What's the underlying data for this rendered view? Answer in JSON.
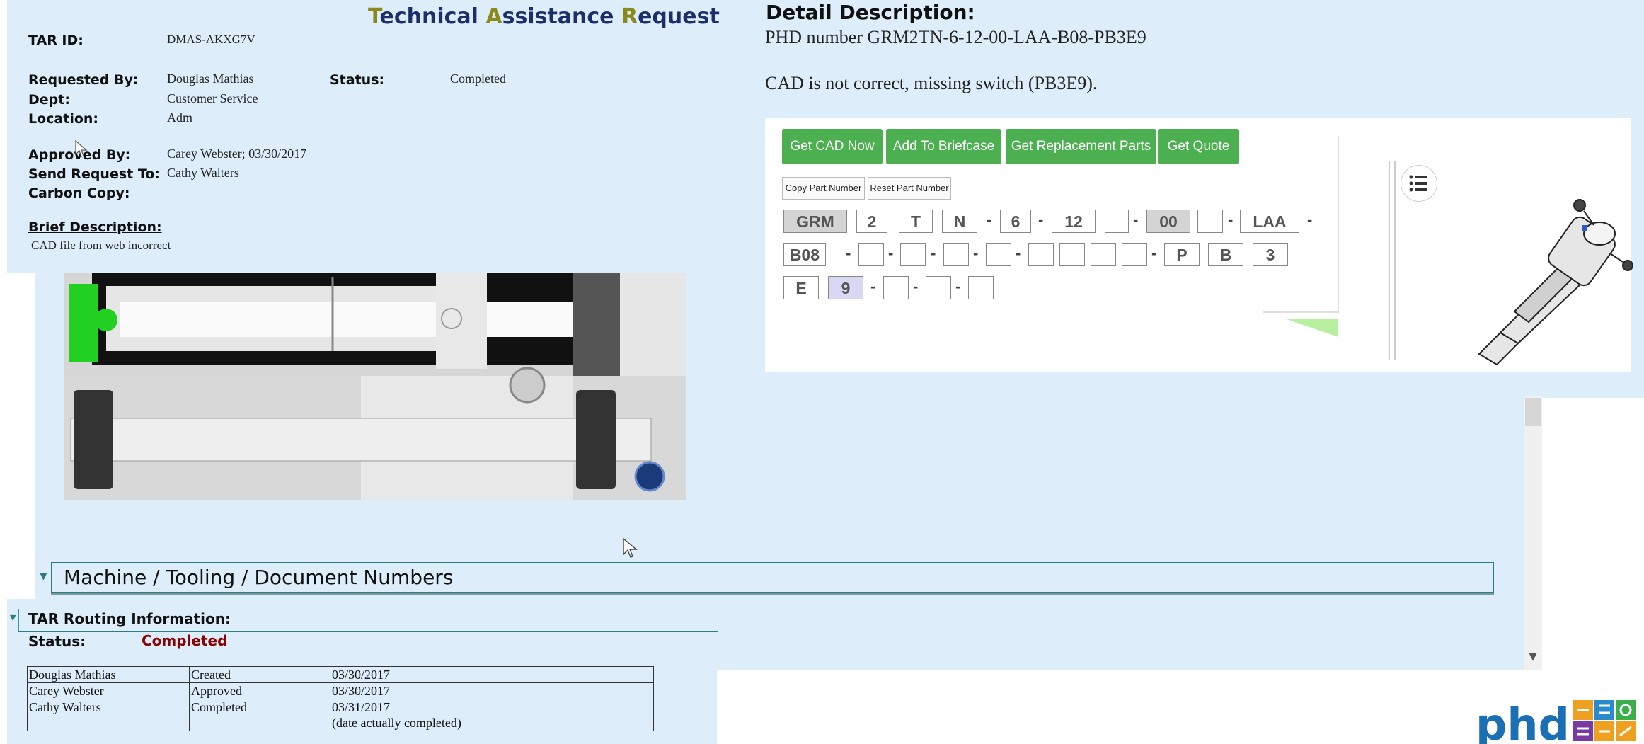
{
  "header": {
    "title_parts": [
      "T",
      "echnical ",
      "A",
      "ssistance ",
      "R",
      "equest"
    ],
    "tar_id_label": "TAR ID:",
    "tar_id": "DMAS-AKXG7V",
    "requested_by_label": "Requested By:",
    "requested_by": "Douglas Mathias",
    "status_label": "Status:",
    "status": "Completed",
    "dept_label": "Dept:",
    "dept": "Customer Service",
    "location_label": "Location:",
    "location": "Adm",
    "approved_by_label": "Approved By:",
    "approved_by": "Carey Webster; 03/30/2017",
    "send_to_label": "Send Request To:",
    "send_to": "Cathy Walters",
    "carbon_copy_label": "Carbon Copy:",
    "brief_label": "Brief Description:",
    "brief": "CAD file from web incorrect"
  },
  "machine": {
    "label": "Machine / Tooling / Document Numbers"
  },
  "routing": {
    "title": "TAR Routing Information:",
    "status_label": "Status:",
    "status": "Completed",
    "rows": [
      {
        "name": "Douglas Mathias",
        "action": "Created",
        "date": "03/30/2017",
        "note": ""
      },
      {
        "name": "Carey Webster",
        "action": "Approved",
        "date": "03/30/2017",
        "note": ""
      },
      {
        "name": "Cathy Walters",
        "action": "Completed",
        "date": "03/31/2017",
        "note": "(date actually completed)"
      }
    ]
  },
  "detail": {
    "title": "Detail Description:",
    "line1": "PHD number GRM2TN-6-12-00-LAA-B08-PB3E9",
    "line2": "CAD is not correct, missing switch (PB3E9)."
  },
  "configurator": {
    "buttons": [
      "Get CAD Now",
      "Add To Briefcase",
      "Get Replacement Parts",
      "Get Quote"
    ],
    "small_buttons": [
      "Copy Part Number",
      "Reset Part Number"
    ],
    "part_boxes": [
      "GRM",
      "2",
      "T",
      "N",
      "6",
      "12",
      "",
      "00",
      "",
      "LAA",
      "B08",
      "",
      "",
      "",
      "",
      "",
      "",
      "",
      "",
      "P",
      "B",
      "3",
      "E",
      "9",
      "",
      "",
      ""
    ],
    "dash": "-"
  },
  "colors": {
    "accent_green": "#4caf50",
    "panel_blue": "#ddeefa",
    "status_red": "#8b0000",
    "title_navy": "#1d2f6b"
  },
  "icons": [
    "menu-icon",
    "cursor-icon",
    "collapse-triangle-icon",
    "scroll-down-icon"
  ],
  "logo": {
    "text": "phd"
  }
}
